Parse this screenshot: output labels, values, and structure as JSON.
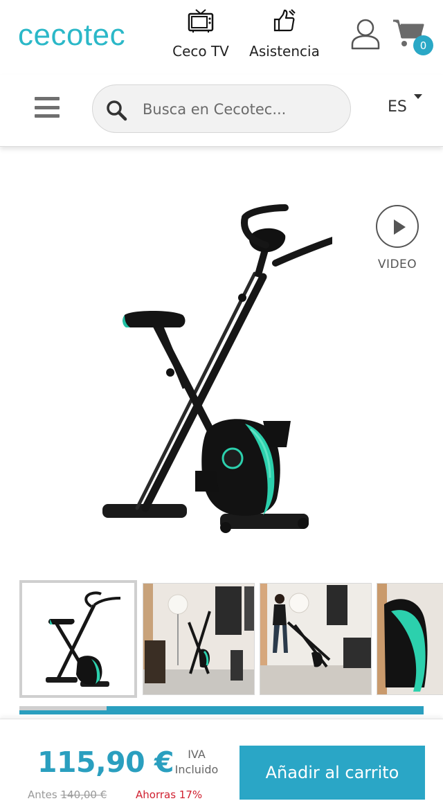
{
  "header": {
    "logo_text": "cecotec",
    "nav": [
      {
        "label": "Ceco TV",
        "icon": "tv-icon"
      },
      {
        "label": "Asistencia",
        "icon": "support-thumbs-up-icon"
      }
    ],
    "user_icon": "user-icon",
    "cart_icon": "shopping-cart-icon",
    "cart_count": "0"
  },
  "search": {
    "placeholder": "Busca en Cecotec...",
    "icon": "search-icon"
  },
  "language": "ES",
  "menu_icon": "hamburger-menu-icon",
  "product": {
    "video_label": "VIDEO",
    "thumbnails": [
      {
        "alt": "Bicicleta estática plegable - vista producto"
      },
      {
        "alt": "Bicicleta en salón"
      },
      {
        "alt": "Mujer moviendo la bicicleta"
      },
      {
        "alt": "Detalle del volante de inercia"
      }
    ]
  },
  "purchase": {
    "price": "115,90 €",
    "tax_line1": "IVA",
    "tax_line2": "Incluido",
    "before_label": "Antes",
    "before_price": "140,00 €",
    "savings": "Ahorras 17%",
    "add_to_cart": "Añadir al carrito"
  },
  "colors": {
    "brand": "#2bb8c8",
    "accent": "#2aa6c6",
    "savings": "#d02030"
  }
}
